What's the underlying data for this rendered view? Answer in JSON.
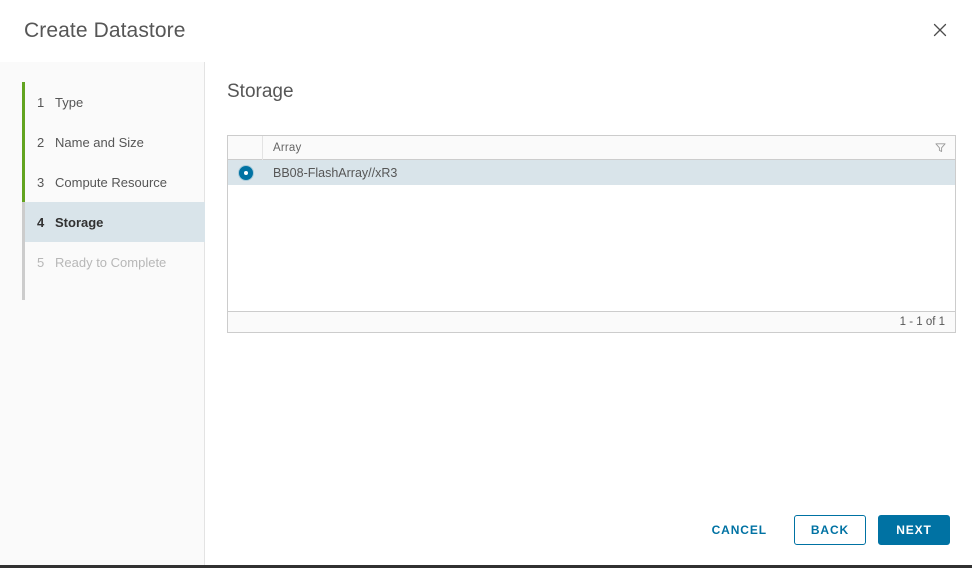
{
  "dialog": {
    "title": "Create Datastore",
    "close_icon": "close-icon"
  },
  "sidebar": {
    "steps": [
      {
        "num": "1",
        "label": "Type",
        "state": "done"
      },
      {
        "num": "2",
        "label": "Name and Size",
        "state": "done"
      },
      {
        "num": "3",
        "label": "Compute Resource",
        "state": "done"
      },
      {
        "num": "4",
        "label": "Storage",
        "state": "active"
      },
      {
        "num": "5",
        "label": "Ready to Complete",
        "state": "disabled"
      }
    ]
  },
  "content": {
    "title": "Storage",
    "table": {
      "columns": [
        "Array"
      ],
      "filter_icon": "filter-icon",
      "rows": [
        {
          "array": "BB08-FlashArray//xR3",
          "selected": true
        }
      ],
      "pagination": "1 - 1 of 1"
    }
  },
  "footer": {
    "cancel_label": "CANCEL",
    "back_label": "BACK",
    "next_label": "NEXT"
  },
  "colors": {
    "accent_blue": "#0072a3",
    "progress_green": "#62a420",
    "selected_row": "#d9e4ea",
    "sidebar_bg": "#fafafa",
    "text": "#565656"
  }
}
